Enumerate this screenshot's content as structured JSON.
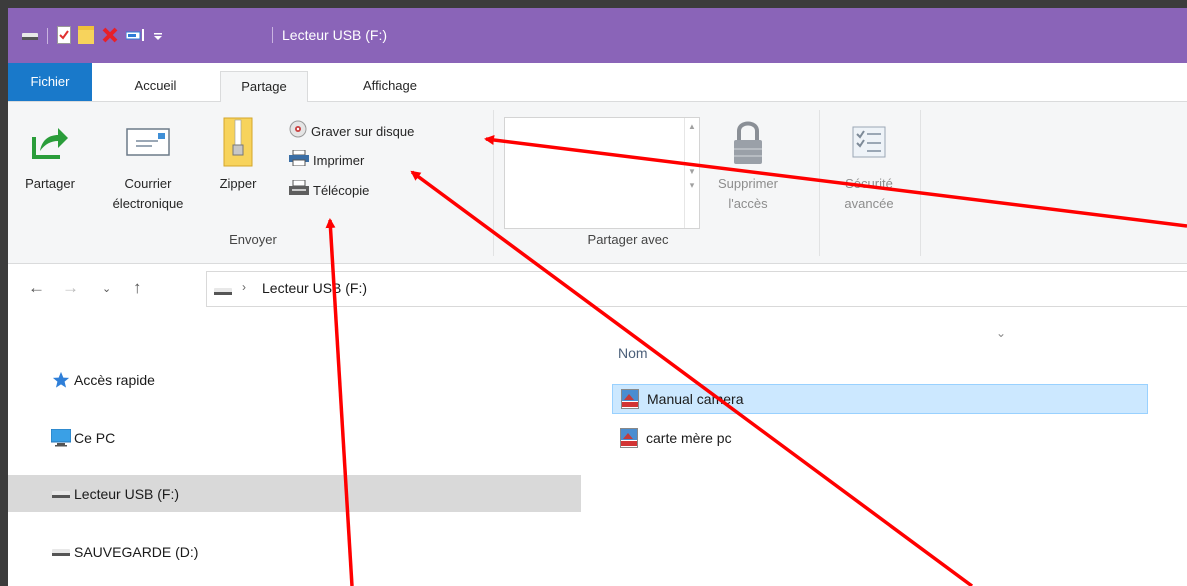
{
  "window": {
    "title": "Lecteur USB (F:)",
    "accent_color": "#8a64b8"
  },
  "tabs": [
    {
      "label": "Fichier"
    },
    {
      "label": "Accueil"
    },
    {
      "label": "Partage"
    },
    {
      "label": "Affichage"
    }
  ],
  "ribbon": {
    "send_group": {
      "label": "Envoyer",
      "share": "Partager",
      "email_line1": "Courrier",
      "email_line2": "électronique",
      "zip": "Zipper",
      "burn": "Graver sur disque",
      "print": "Imprimer",
      "fax": "Télécopie"
    },
    "share_with_group": {
      "label": "Partager avec",
      "remove_line1": "Supprimer",
      "remove_line2": "l'accès",
      "advanced_line1": "Sécurité",
      "advanced_line2": "avancée"
    }
  },
  "address": {
    "path": "Lecteur USB (F:)"
  },
  "nav": {
    "items": [
      {
        "label": "Accès rapide",
        "icon": "star-icon"
      },
      {
        "label": "Ce PC",
        "icon": "monitor-icon"
      },
      {
        "label": "Lecteur USB (F:)",
        "icon": "drive-icon"
      },
      {
        "label": "SAUVEGARDE (D:)",
        "icon": "drive-icon"
      }
    ]
  },
  "files": {
    "column_name": "Nom",
    "rows": [
      {
        "name": "Manual camera",
        "icon": "pdf-file-icon"
      },
      {
        "name": "carte mère pc",
        "icon": "pdf-file-icon"
      }
    ]
  },
  "annotation_color": "#ff0000"
}
